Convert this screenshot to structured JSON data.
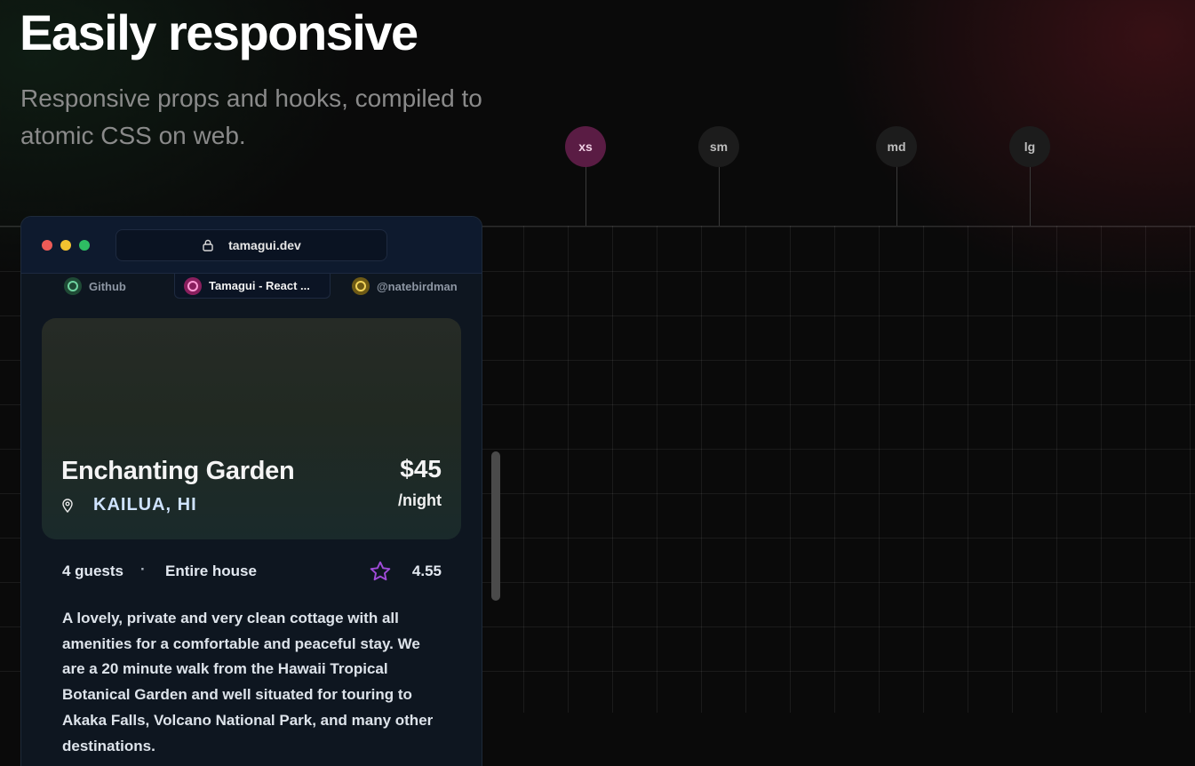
{
  "hero": {
    "title": "Easily responsive",
    "subtitle": "Responsive props and hooks, compiled to atomic CSS on web."
  },
  "breakpoints": [
    {
      "label": "xs",
      "active": true
    },
    {
      "label": "sm",
      "active": false
    },
    {
      "label": "md",
      "active": false
    },
    {
      "label": "lg",
      "active": false
    }
  ],
  "browser": {
    "url": "tamagui.dev",
    "tabs": [
      {
        "label": "Github",
        "color": "#2f6b4a",
        "active": false
      },
      {
        "label": "Tamagui - React ...",
        "color": "#b8327a",
        "active": true
      },
      {
        "label": "@natebirdman",
        "color": "#b89a2a",
        "active": false
      }
    ]
  },
  "listing": {
    "title": "Enchanting Garden",
    "location": "KAILUA, HI",
    "price": "$45",
    "per": "/night",
    "guests": "4 guests",
    "separator": "·",
    "type": "Entire house",
    "rating": "4.55",
    "description": "A lovely, private and very clean cottage with all amenities for a comfortable and peaceful stay. We are a 20 minute walk from the Hawaii Tropical Botanical Garden and well situated for touring to Akaka Falls, Volcano National Park, and many other destinations."
  },
  "colors": {
    "accent": "#5a1c44",
    "star": "#a04bd8"
  }
}
